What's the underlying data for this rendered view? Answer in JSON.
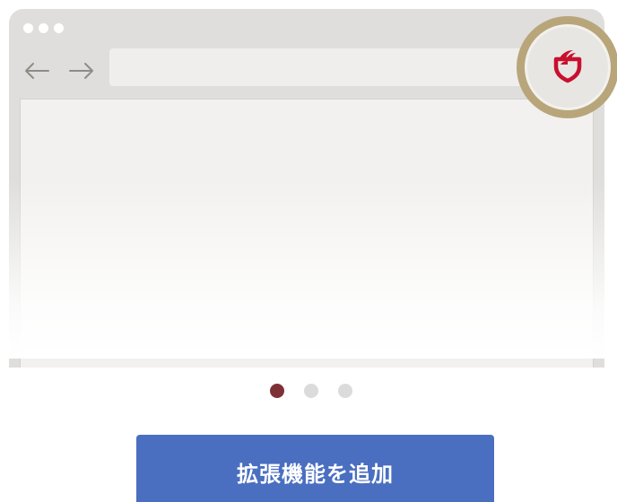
{
  "browser": {
    "window_controls": [
      "dot",
      "dot",
      "dot"
    ],
    "back_icon": "arrow-left-icon",
    "forward_icon": "arrow-right-icon",
    "address_value": "",
    "extension_icon": "shield-logo-icon"
  },
  "pagination": {
    "total": 3,
    "active_index": 0
  },
  "cta": {
    "label": "拡張機能を追加"
  },
  "colors": {
    "browser_chrome": "#dfdedc",
    "highlight_ring": "#b8a67a",
    "shield_red": "#c8102e",
    "pager_active": "#7e3135",
    "pager_inactive": "#dbdbdb",
    "cta_background": "#4a6ec0"
  }
}
